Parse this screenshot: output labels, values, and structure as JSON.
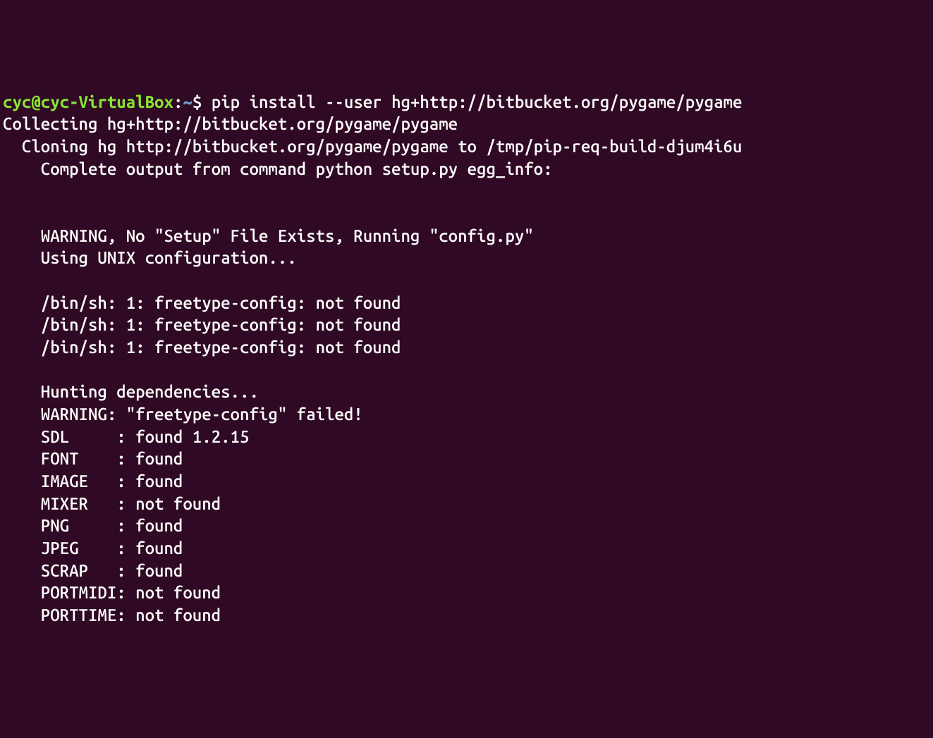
{
  "prompt": {
    "user": "cyc",
    "at": "@",
    "host": "cyc-VirtualBox",
    "colon": ":",
    "path": "~",
    "dollar": "$ "
  },
  "command": "pip install --user hg+http://bitbucket.org/pygame/pygame",
  "lines": {
    "l0": "Collecting hg+http://bitbucket.org/pygame/pygame",
    "l1": "  Cloning hg http://bitbucket.org/pygame/pygame to /tmp/pip-req-build-djum4i6u",
    "l2": "    Complete output from command python setup.py egg_info:",
    "l3": "    ",
    "l4": "    ",
    "l5": "    WARNING, No \"Setup\" File Exists, Running \"config.py\"",
    "l6": "    Using UNIX configuration...",
    "l7": "    ",
    "l8": "    /bin/sh: 1: freetype-config: not found",
    "l9": "    /bin/sh: 1: freetype-config: not found",
    "l10": "    /bin/sh: 1: freetype-config: not found",
    "l11": "    ",
    "l12": "    Hunting dependencies...",
    "l13": "    WARNING: \"freetype-config\" failed!",
    "l14": "    SDL     : found 1.2.15",
    "l15": "    FONT    : found",
    "l16": "    IMAGE   : found",
    "l17": "    MIXER   : not found",
    "l18": "    PNG     : found",
    "l19": "    JPEG    : found",
    "l20": "    SCRAP   : found",
    "l21": "    PORTMIDI: not found",
    "l22": "    PORTTIME: not found"
  }
}
